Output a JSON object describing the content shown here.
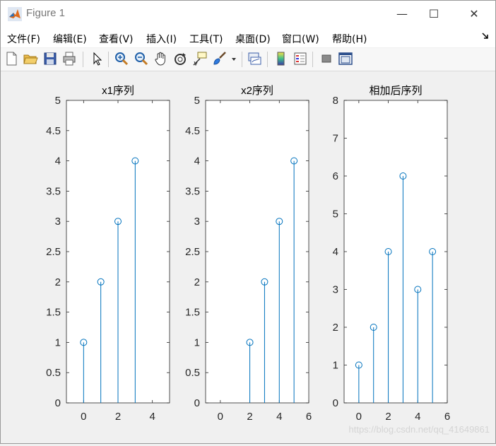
{
  "window": {
    "title": "Figure 1",
    "controls": {
      "minimize": "—",
      "maximize": "☐",
      "close": "✕"
    }
  },
  "menubar": {
    "items": [
      "文件(F)",
      "编辑(E)",
      "查看(V)",
      "插入(I)",
      "工具(T)",
      "桌面(D)",
      "窗口(W)",
      "帮助(H)"
    ],
    "overflow_icon": "arrow-icon"
  },
  "toolbar": {
    "icons": [
      "new-figure-icon",
      "open-file-icon",
      "save-icon",
      "print-icon",
      "edit-plot-arrow-icon",
      "zoom-in-icon",
      "zoom-out-icon",
      "pan-hand-icon",
      "rotate-3d-icon",
      "data-cursor-icon",
      "brush-icon",
      "brush-dropdown-icon",
      "link-plot-icon",
      "colorbar-icon",
      "legend-icon",
      "hide-plot-tools-icon",
      "show-plot-tools-icon"
    ]
  },
  "watermark": "https://blog.csdn.net/qq_41649861",
  "chart_data": [
    {
      "type": "stem",
      "title": "x1序列",
      "x": [
        0,
        1,
        2,
        3
      ],
      "y": [
        1,
        2,
        3,
        4
      ],
      "xlim": [
        -1,
        5
      ],
      "ylim": [
        0,
        5
      ],
      "xticks": [
        "0",
        "2",
        "4"
      ],
      "yticks": [
        "0",
        "0.5",
        "1",
        "1.5",
        "2",
        "2.5",
        "3",
        "3.5",
        "4",
        "4.5",
        "5"
      ],
      "color": "#0072bd"
    },
    {
      "type": "stem",
      "title": "x2序列",
      "x": [
        2,
        3,
        4,
        5
      ],
      "y": [
        1,
        2,
        3,
        4
      ],
      "xlim": [
        -1,
        6
      ],
      "ylim": [
        0,
        5
      ],
      "xticks": [
        "0",
        "2",
        "4",
        "6"
      ],
      "yticks": [
        "0",
        "0.5",
        "1",
        "1.5",
        "2",
        "2.5",
        "3",
        "3.5",
        "4",
        "4.5",
        "5"
      ],
      "color": "#0072bd"
    },
    {
      "type": "stem",
      "title": "相加后序列",
      "x": [
        0,
        1,
        2,
        3,
        4,
        5
      ],
      "y": [
        1,
        2,
        4,
        6,
        3,
        4
      ],
      "xlim": [
        -1,
        6
      ],
      "ylim": [
        0,
        8
      ],
      "xticks": [
        "0",
        "2",
        "4",
        "6"
      ],
      "yticks": [
        "0",
        "1",
        "2",
        "3",
        "4",
        "5",
        "6",
        "7",
        "8"
      ],
      "color": "#0072bd"
    }
  ]
}
